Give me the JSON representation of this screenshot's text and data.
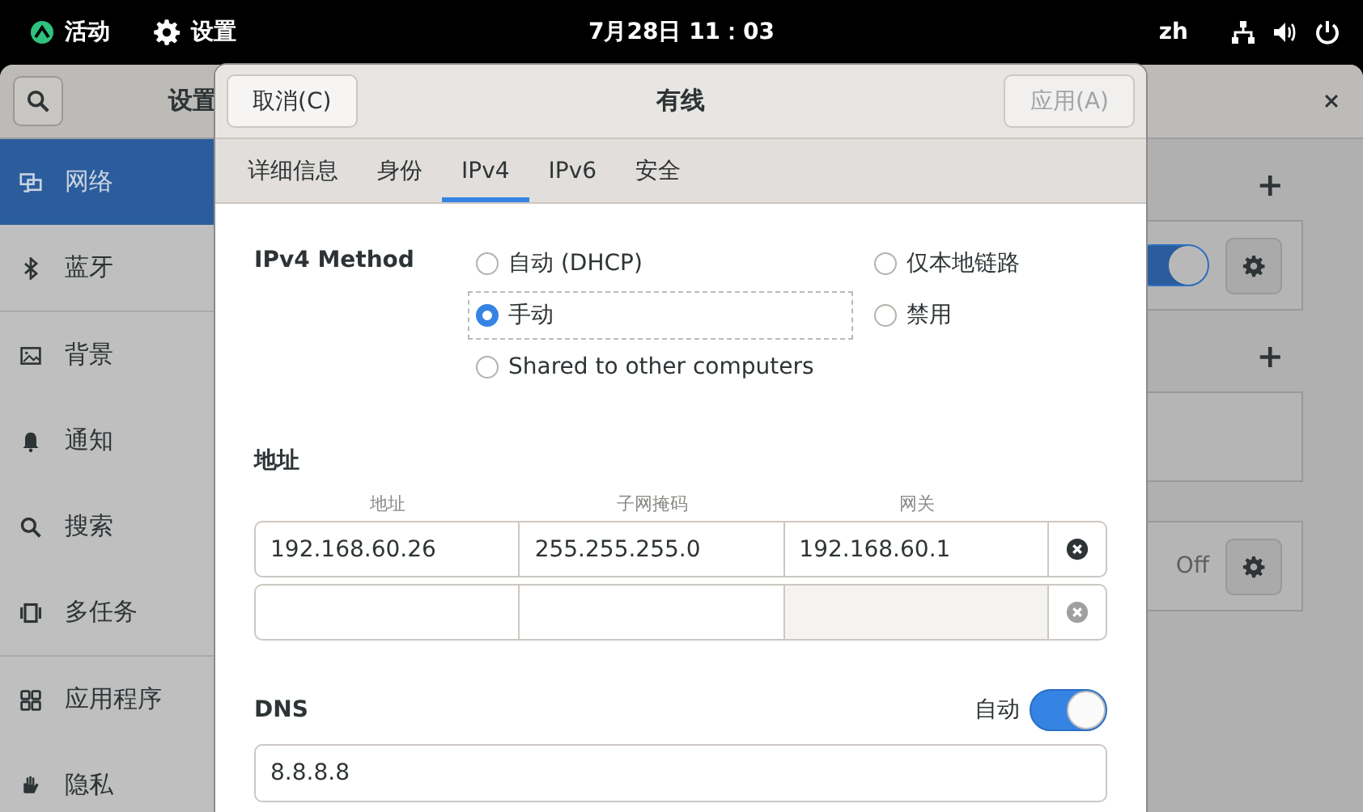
{
  "top_bar": {
    "activities": "活动",
    "app_menu": "设置",
    "clock": "7月28日  11：03",
    "input_method": "zh"
  },
  "settings_window": {
    "title": "设置",
    "sidebar": {
      "groups": [
        [
          {
            "label": "网络",
            "selected": true
          },
          {
            "label": "蓝牙",
            "selected": false
          }
        ],
        [
          {
            "label": "背景",
            "selected": false
          },
          {
            "label": "通知",
            "selected": false
          },
          {
            "label": "搜索",
            "selected": false
          },
          {
            "label": "多任务",
            "selected": false
          }
        ],
        [
          {
            "label": "应用程序",
            "selected": false
          },
          {
            "label": "隐私",
            "selected": false
          }
        ]
      ]
    },
    "panel": {
      "sections": [
        {
          "add": "+",
          "row": {
            "kind": "switch",
            "on": true
          }
        },
        {
          "add": "+",
          "row": {
            "kind": "empty"
          }
        },
        {
          "row": {
            "kind": "status",
            "text": "Off"
          }
        }
      ]
    }
  },
  "dialog": {
    "title": "有线",
    "cancel": "取消(C)",
    "apply": {
      "label": "应用(A)",
      "disabled": true
    },
    "tabs": [
      {
        "label": "详细信息",
        "selected": false
      },
      {
        "label": "身份",
        "selected": false
      },
      {
        "label": "IPv4",
        "selected": true
      },
      {
        "label": "IPv6",
        "selected": false
      },
      {
        "label": "安全",
        "selected": false
      }
    ],
    "ipv4_method": {
      "label": "IPv4 Method",
      "options": [
        {
          "label": "自动 (DHCP)",
          "selected": false,
          "focused": false
        },
        {
          "label": "手动",
          "selected": true,
          "focused": true
        },
        {
          "label": "Shared to other computers",
          "selected": false,
          "focused": false
        },
        {
          "label": "仅本地链路",
          "selected": false,
          "focused": false
        },
        {
          "label": "禁用",
          "selected": false,
          "focused": false
        }
      ]
    },
    "addresses": {
      "heading": "地址",
      "columns": [
        "地址",
        "子网掩码",
        "网关"
      ],
      "rows": [
        {
          "kind": "filled",
          "cells": [
            "192.168.60.26",
            "255.255.255.0",
            "192.168.60.1"
          ],
          "removable": true
        },
        {
          "kind": "blank",
          "removable": false
        }
      ]
    },
    "dns": {
      "heading": "DNS",
      "auto_label": "自动",
      "auto": true,
      "value": "8.8.8.8"
    }
  }
}
